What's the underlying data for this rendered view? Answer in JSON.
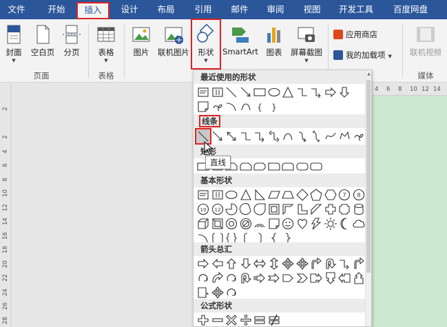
{
  "menu": {
    "tabs": [
      {
        "label": "文件"
      },
      {
        "label": "开始"
      },
      {
        "label": "插入"
      },
      {
        "label": "设计"
      },
      {
        "label": "布局"
      },
      {
        "label": "引用"
      },
      {
        "label": "邮件"
      },
      {
        "label": "审阅"
      },
      {
        "label": "视图"
      },
      {
        "label": "开发工具"
      },
      {
        "label": "百度网盘"
      }
    ],
    "active": "插入"
  },
  "ribbon": {
    "cover": "封面",
    "blank": "空白页",
    "pagebreak": "分页",
    "group_pages": "页面",
    "table": "表格",
    "group_table": "表格",
    "picture": "图片",
    "online_picture": "联机图片",
    "shapes": "形状",
    "smartart": "SmartArt",
    "chart": "图表",
    "screenshot": "屏幕截图",
    "store": "应用商店",
    "my_addins": "我的加载项",
    "online_video": "联机视频",
    "group_media": "媒体"
  },
  "shapes_panel": {
    "recent": "最近使用的形状",
    "lines": "线条",
    "rect": "矩形",
    "basic": "基本形状",
    "arrows": "箭头总汇",
    "equation": "公式形状"
  },
  "tooltip": "直线",
  "ruler": {
    "left": [
      "2",
      "",
      "2",
      "4",
      "6",
      "8",
      "10",
      "12",
      "14",
      "16",
      "18",
      "20",
      "22",
      "24",
      "26",
      "28"
    ],
    "top": [
      "4",
      "6",
      "8",
      "10",
      "12",
      "14"
    ]
  },
  "colors": {
    "accent": "#2b579a",
    "highlight": "#e02020",
    "doc_bg": "#cce8d0"
  }
}
